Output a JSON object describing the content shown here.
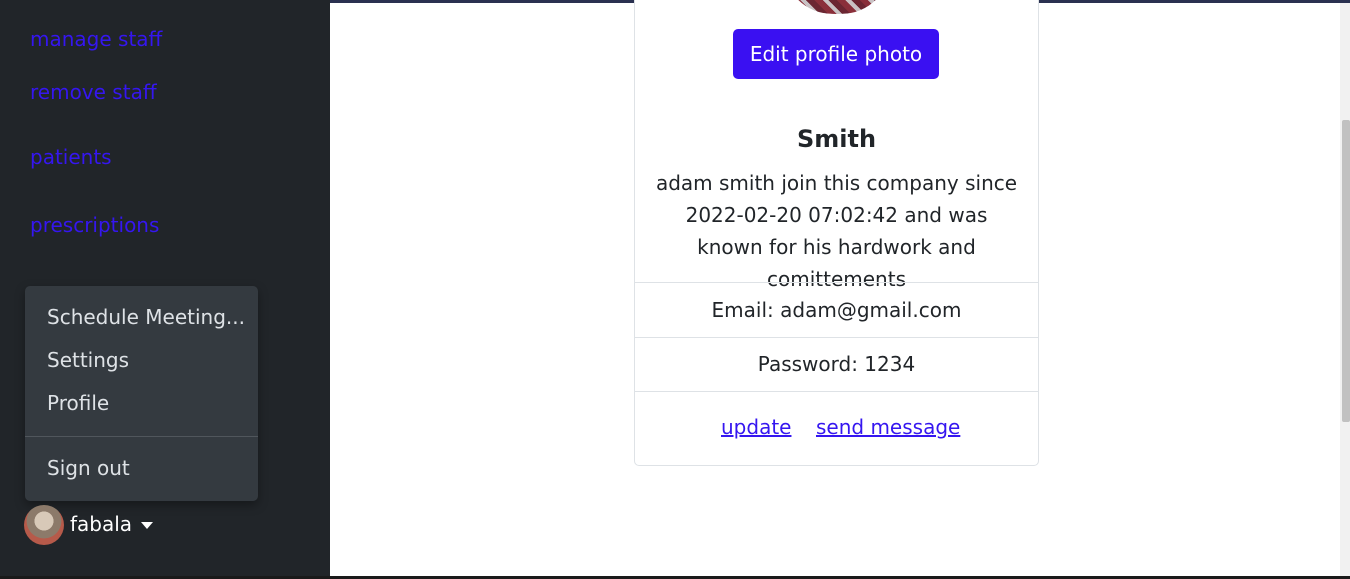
{
  "sidebar": {
    "items": [
      {
        "label": "manage staff"
      },
      {
        "label": "remove staff"
      },
      {
        "label": "patients"
      },
      {
        "label": "prescriptions"
      }
    ],
    "link_color": "#3516f0",
    "background": "#212529"
  },
  "dropdown": {
    "items": [
      {
        "label": "Schedule Meeting..."
      },
      {
        "label": "Settings"
      },
      {
        "label": "Profile"
      }
    ],
    "signout_label": "Sign out"
  },
  "user": {
    "name": "fabala",
    "avatar_icon": "user-avatar"
  },
  "profile": {
    "edit_photo_label": "Edit profile photo",
    "name": "Smith",
    "bio": "adam smith join this company since 2022-02-20 07:02:42 and was known for his hardwork and comittements",
    "email": "Email: adam@gmail.com",
    "password": "Password: 1234",
    "update_label": "update",
    "send_message_label": "send message",
    "button_color": "#3a10f2"
  }
}
